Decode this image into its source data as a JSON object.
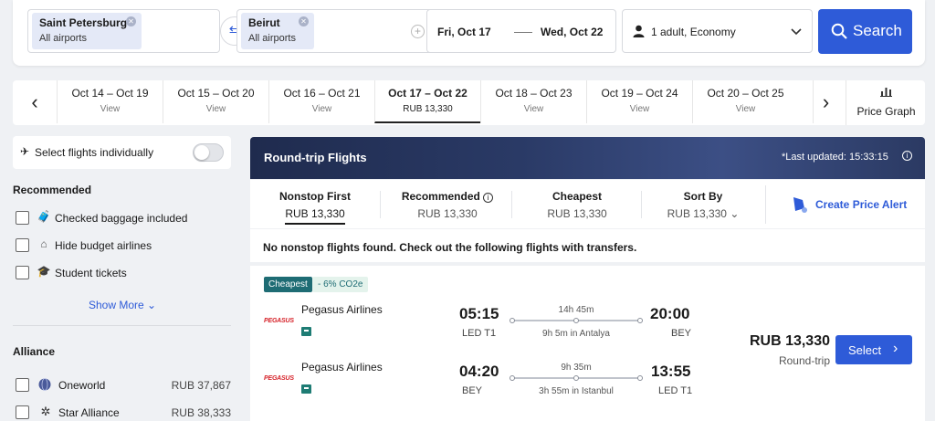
{
  "search": {
    "origin": {
      "name": "Saint Petersburg",
      "sub": "All airports"
    },
    "destination": {
      "name": "Beirut",
      "sub": "All airports"
    },
    "depart_date": "Fri, Oct 17",
    "return_date": "Wed, Oct 22",
    "passengers": "1 adult, Economy",
    "search_label": "Search"
  },
  "date_strip": {
    "tabs": [
      {
        "range": "Oct 14 – Oct 19",
        "value": "View"
      },
      {
        "range": "Oct 15 – Oct 20",
        "value": "View"
      },
      {
        "range": "Oct 16 – Oct 21",
        "value": "View"
      },
      {
        "range": "Oct 17 – Oct 22",
        "value": "RUB 13,330"
      },
      {
        "range": "Oct 18 – Oct 23",
        "value": "View"
      },
      {
        "range": "Oct 19 – Oct 24",
        "value": "View"
      },
      {
        "range": "Oct 20 – Oct 25",
        "value": "View"
      }
    ],
    "price_graph_label": "Price Graph"
  },
  "sidebar": {
    "toggle_label": "Select flights individually",
    "recommended_title": "Recommended",
    "recommended": [
      {
        "label": "Checked baggage included",
        "icon": "baggage-icon"
      },
      {
        "label": "Hide budget airlines",
        "icon": "tag-icon"
      },
      {
        "label": "Student tickets",
        "icon": "graduation-cap-icon"
      }
    ],
    "show_more": "Show More",
    "alliance_title": "Alliance",
    "alliances": [
      {
        "label": "Oneworld",
        "price": "RUB 37,867",
        "icon": "globe-icon"
      },
      {
        "label": "Star Alliance",
        "price": "RUB 38,333",
        "icon": "star-icon"
      }
    ]
  },
  "banner": {
    "title": "Round-trip Flights",
    "updated": "*Last updated: 15:33:15"
  },
  "sort": {
    "options": [
      {
        "title": "Nonstop First",
        "value": "RUB 13,330"
      },
      {
        "title": "Recommended",
        "value": "RUB 13,330"
      },
      {
        "title": "Cheapest",
        "value": "RUB 13,330"
      },
      {
        "title": "Sort By",
        "value": "RUB 13,330"
      }
    ],
    "alert_label": "Create Price Alert"
  },
  "notice": "No nonstop flights found. Check out the following flights with transfers.",
  "result": {
    "badge": "Cheapest",
    "co2": "- 6% CO2e",
    "legs": [
      {
        "logo": "PEGASUS",
        "airline": "Pegasus Airlines",
        "dep_time": "05:15",
        "dep_apt": "LED T1",
        "duration": "14h 45m",
        "stop": "9h 5m in Antalya",
        "arr_time": "20:00",
        "arr_apt": "BEY"
      },
      {
        "logo": "PEGASUS",
        "airline": "Pegasus Airlines",
        "dep_time": "04:20",
        "dep_apt": "BEY",
        "duration": "9h 35m",
        "stop": "3h 55m in Istanbul",
        "arr_time": "13:55",
        "arr_apt": "LED T1"
      }
    ],
    "price": "RUB 13,330",
    "price_sub": "Round-trip",
    "select_label": "Select"
  },
  "colors": {
    "accent": "#2e5bd8",
    "badge": "#1e6c74",
    "airline_logo": "#d6232a"
  }
}
